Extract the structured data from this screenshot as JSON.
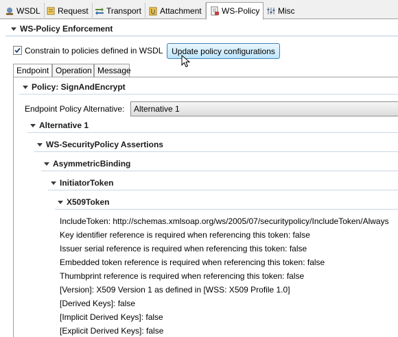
{
  "tabs": [
    {
      "label": "WSDL",
      "icon": "wsdl-icon"
    },
    {
      "label": "Request",
      "icon": "request-icon"
    },
    {
      "label": "Transport",
      "icon": "transport-icon"
    },
    {
      "label": "Attachment",
      "icon": "attachment-icon"
    },
    {
      "label": "WS-Policy",
      "icon": "ws-policy-icon",
      "active": true
    },
    {
      "label": "Misc",
      "icon": "misc-icon"
    }
  ],
  "section": {
    "title": "WS-Policy Enforcement"
  },
  "constrain": {
    "label": "Constrain to policies defined in WSDL",
    "checked": true
  },
  "update_button": {
    "label": "Update policy configurations"
  },
  "subtabs": [
    {
      "label": "Endpoint",
      "active": true
    },
    {
      "label": "Operation"
    },
    {
      "label": "Message"
    }
  ],
  "policy": {
    "title": "Policy: SignAndEncrypt"
  },
  "alternative_field": {
    "label": "Endpoint Policy Alternative:",
    "value": "Alternative 1"
  },
  "tree": {
    "alternative": "Alternative 1",
    "assertions": "WS-SecurityPolicy Assertions",
    "binding": "AsymmetricBinding",
    "initiator": "InitiatorToken",
    "token": "X509Token"
  },
  "properties": [
    "IncludeToken: http://schemas.xmlsoap.org/ws/2005/07/securitypolicy/IncludeToken/Always",
    "Key identifier reference is required when referencing this token: false",
    "Issuer serial reference is required when referencing this token: false",
    "Embedded token reference is required when referencing this token: false",
    "Thumbprint reference is required when referencing this token: false",
    "[Version]: X509 Version 1 as defined in [WSS: X509 Profile 1.0]",
    "[Derived Keys]: false",
    "[Implicit Derived Keys]: false",
    "[Explicit Derived Keys]: false"
  ]
}
